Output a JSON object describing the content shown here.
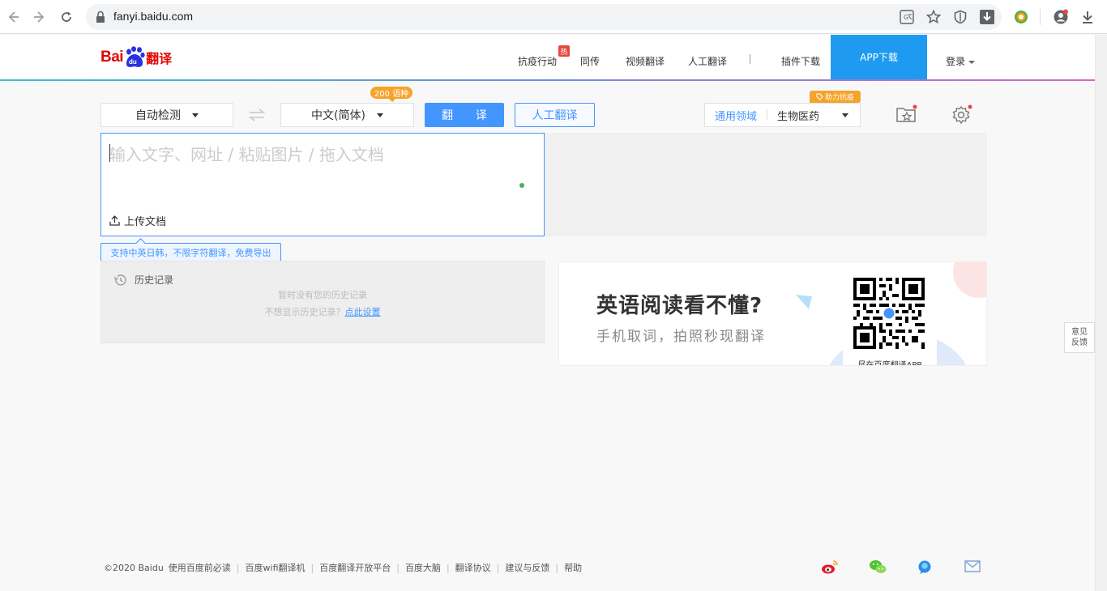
{
  "browser": {
    "url": "fanyi.baidu.com"
  },
  "header": {
    "logo_text_bai": "Bai",
    "logo_text_fanyi": "翻译",
    "nav": [
      {
        "label": "抗疫行动"
      },
      {
        "label": "同传"
      },
      {
        "label": "视频翻译"
      },
      {
        "label": "人工翻译"
      },
      {
        "label": "插件下载"
      }
    ],
    "hot_badge": "热",
    "app_download": "APP下载",
    "login": "登录"
  },
  "toolbar": {
    "source_lang": "自动检测",
    "target_lang": "中文(简体)",
    "lang_count_badge": "200 语种",
    "translate_button": "翻 译",
    "human_translate_button": "人工翻译",
    "domain_label": "通用领域",
    "domain_value": "生物医药",
    "help_badge": "助力抗疫"
  },
  "input": {
    "placeholder": "输入文字、网址 / 粘贴图片 / 拖入文档",
    "upload_label": "上传文档",
    "tip": "支持中英日韩，不限字符翻译，免费导出"
  },
  "history": {
    "title": "历史记录",
    "empty": "暂时没有您的历史记录",
    "hint_prefix": "不想显示历史记录？",
    "hint_link": "点此设置"
  },
  "ad": {
    "title": "英语阅读看不懂?",
    "subtitle": "手机取词，拍照秒现翻译",
    "qr_caption": "尽在百度翻译APP"
  },
  "feedback": {
    "line1": "意见",
    "line2": "反馈"
  },
  "footer": {
    "copyright": "©2020 Baidu",
    "links": [
      "使用百度前必读",
      "百度wifi翻译机",
      "百度翻译开放平台",
      "百度大脑",
      "翻译协议",
      "建议与反馈",
      "帮助"
    ]
  },
  "colors": {
    "accent": "#4395ff",
    "brand_red": "#e10602",
    "app_button": "#1e9bf0",
    "badge_orange": "#f6a32a"
  }
}
